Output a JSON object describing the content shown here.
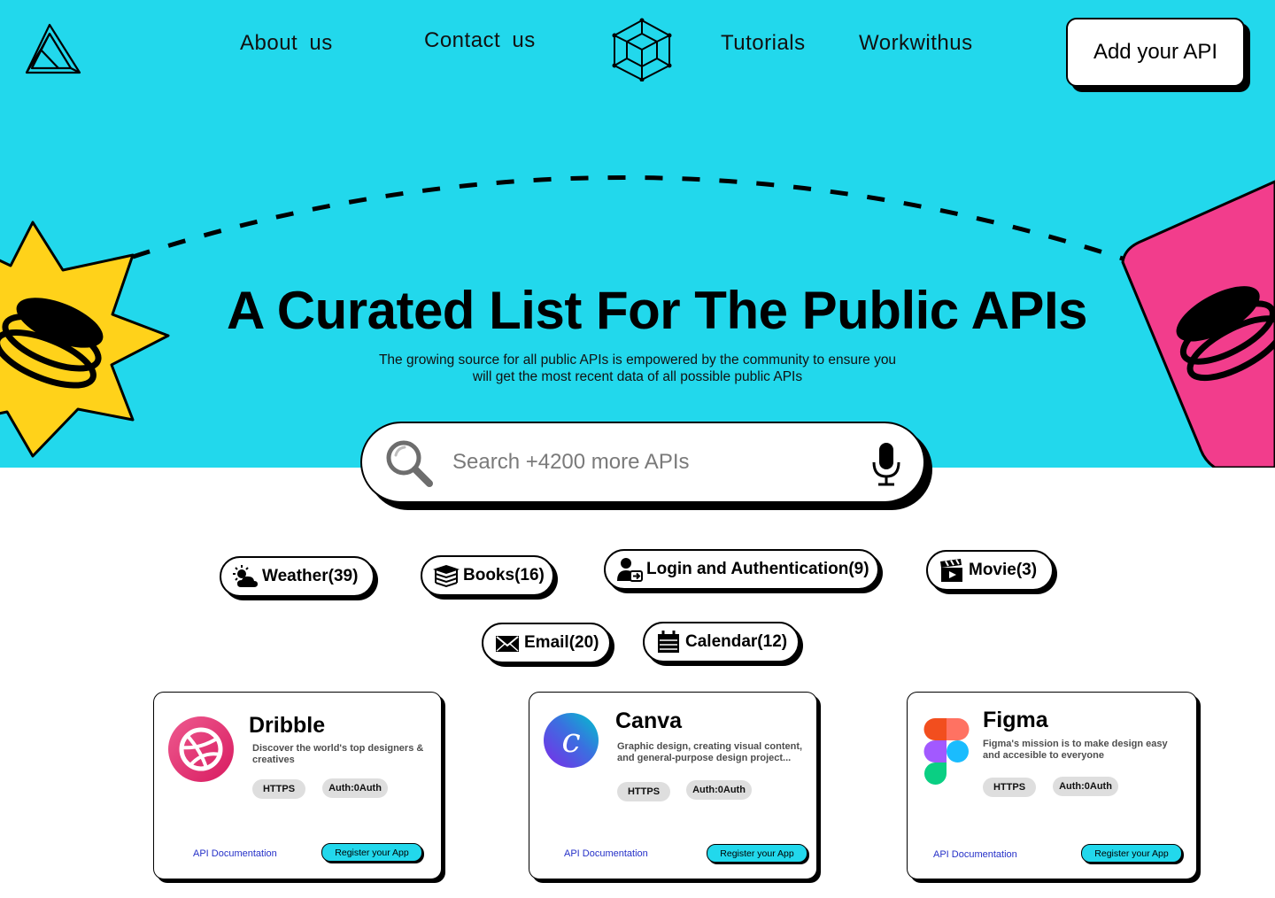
{
  "nav": {
    "about": "About us",
    "contact": "Contact us",
    "tutorials": "Tutorials",
    "work": "Workwithus",
    "add_api": "Add your API"
  },
  "hero": {
    "title": "A Curated List For The Public APIs",
    "subtitle_line1": "The growing source for all public APIs is empowered by the community to ensure you",
    "subtitle_line2": "will get the most recent data of all possible public APIs"
  },
  "search": {
    "placeholder": "Search +4200 more APIs"
  },
  "categories": [
    {
      "label": "Weather(39)",
      "icon": "weather-icon"
    },
    {
      "label": "Books(16)",
      "icon": "books-icon"
    },
    {
      "label": "Login and Authentication(9)",
      "icon": "login-user-icon"
    },
    {
      "label": "Movie(3)",
      "icon": "clapperboard-icon"
    },
    {
      "label": "Email(20)",
      "icon": "envelope-icon"
    },
    {
      "label": "Calendar(12)",
      "icon": "calendar-icon"
    }
  ],
  "cards": [
    {
      "name": "Dribble",
      "desc": "Discover the world's top designers & creatives",
      "tag1": "HTTPS",
      "tag2": "Auth:0Auth",
      "doc": "API Documentation",
      "register": "Register your App",
      "logo": "dribbble-logo"
    },
    {
      "name": "Canva",
      "desc": "Graphic design, creating visual content, and general-purpose design project...",
      "tag1": "HTTPS",
      "tag2": "Auth:0Auth",
      "doc": "API Documentation",
      "register": "Register your App",
      "logo": "canva-logo"
    },
    {
      "name": "Figma",
      "desc": "Figma's mission is to make design easy and accesible to everyone",
      "tag1": "HTTPS",
      "tag2": "Auth:0Auth",
      "doc": "API Documentation",
      "register": "Register your App",
      "logo": "figma-logo"
    }
  ],
  "colors": {
    "hero_bg": "#22d8ec",
    "star": "#ffd21a",
    "pink": "#f23d8c",
    "accent": "#22d8ec"
  }
}
